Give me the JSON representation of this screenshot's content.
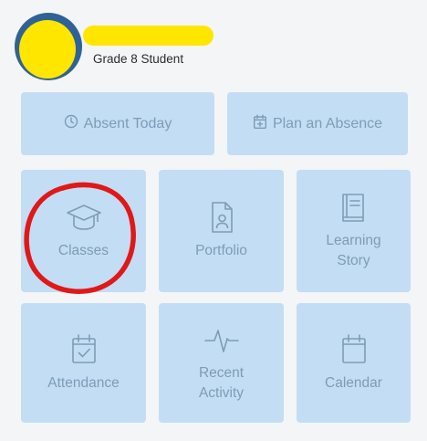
{
  "profile": {
    "subtitle": "Grade 8 Student"
  },
  "actions": {
    "absent_today": "Absent Today",
    "plan_absence": "Plan an Absence"
  },
  "tiles": {
    "classes": "Classes",
    "portfolio": "Portfolio",
    "learning_line1": "Learning",
    "learning_line2": "Story",
    "attendance": "Attendance",
    "recent_line1": "Recent",
    "recent_line2": "Activity",
    "calendar": "Calendar"
  },
  "colors": {
    "tile_background": "#c3ddf5",
    "tile_foreground": "#7e9cb6",
    "page_background": "#f4f5f7",
    "avatar": "#2f6396",
    "redaction": "#ffe600",
    "highlight": "#e01818"
  },
  "icons": {
    "absent_today": "clock-icon",
    "plan_absence": "calendar-plus-icon",
    "classes": "graduation-cap-icon",
    "portfolio": "portfolio-document-icon",
    "learning_story": "book-icon",
    "attendance": "calendar-check-icon",
    "recent_activity": "activity-pulse-icon",
    "calendar": "calendar-icon"
  }
}
